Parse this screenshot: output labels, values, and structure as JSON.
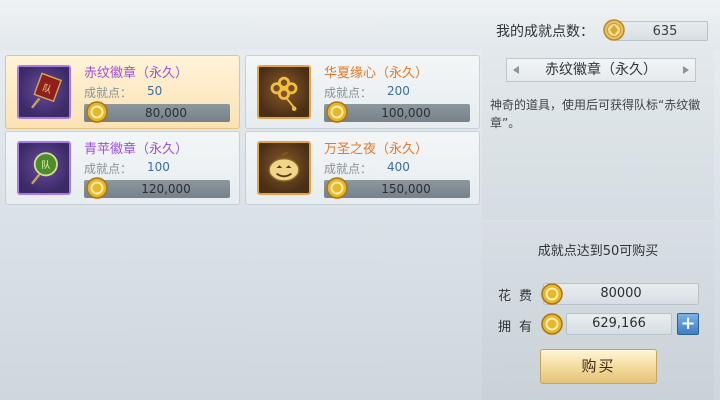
{
  "header": {
    "points_label": "我的成就点数：",
    "points_value": "635",
    "points_icon": "achievement-coin-icon"
  },
  "items": [
    {
      "name": "赤纹徽章（永久）",
      "name_color": "purple",
      "req_label": "成就点：",
      "req_value": "50",
      "cost": "80,000",
      "icon": "badge-banner-icon",
      "selected": true
    },
    {
      "name": "华夏缘心（永久）",
      "name_color": "orange",
      "req_label": "成就点：",
      "req_value": "200",
      "cost": "100,000",
      "icon": "chinese-knot-icon",
      "selected": false
    },
    {
      "name": "青苹徽章（永久）",
      "name_color": "purple",
      "req_label": "成就点：",
      "req_value": "100",
      "cost": "120,000",
      "icon": "badge-round-icon",
      "selected": false
    },
    {
      "name": "万圣之夜（永久）",
      "name_color": "orange",
      "req_label": "成就点：",
      "req_value": "400",
      "cost": "150,000",
      "icon": "pumpkin-icon",
      "selected": false
    }
  ],
  "detail": {
    "title": "赤纹徽章（永久）",
    "description": "神奇的道具，使用后可获得队标“赤纹徽章”。"
  },
  "purchase": {
    "hint": "成就点达到50可购买",
    "cost_label": "花费",
    "cost_value": "80000",
    "own_label": "拥有",
    "own_value": "629,166",
    "plus_label": "+",
    "buy_label": "购买"
  },
  "colors": {
    "purple_name": "#9a52d6",
    "orange_name": "#e07a2a",
    "selected_card": "#fbe2b3",
    "accent_blue": "#3b7fc4"
  }
}
